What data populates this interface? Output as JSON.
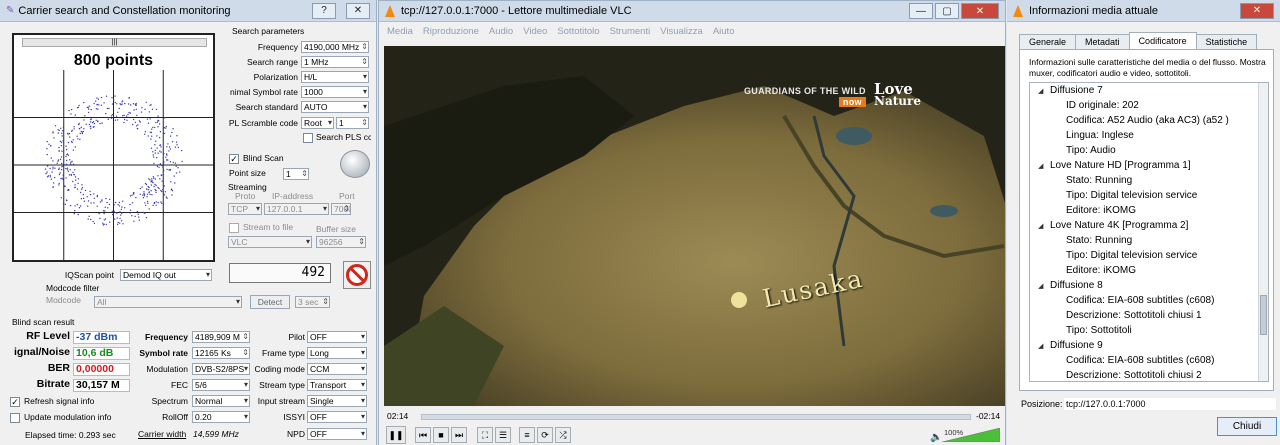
{
  "carrier": {
    "title": "Carrier search and Constellation monitoring",
    "title_btns": [
      "?",
      "✕"
    ],
    "constellation_title": "800 points",
    "scroll_label": "|||",
    "iqscan_label": "IQScan point",
    "iqscan_value": "Demod IQ out",
    "modcode_filter_label": "Modcode filter",
    "modcode_label": "Modcode",
    "modcode_value": "All",
    "detect_label": "Detect",
    "detect_sec": "3 sec",
    "counter": "492",
    "search_params": {
      "header": "Search parameters",
      "frequency_label": "Frequency",
      "frequency": "4190,000 MHz",
      "range_label": "Search range",
      "range": "1 MHz",
      "polarization_label": "Polarization",
      "polarization": "H/L",
      "symbol_label": "nimal Symbol rate",
      "symbol": "1000",
      "standard_label": "Search standard",
      "standard": "AUTO",
      "pl_label": "PL Scramble code",
      "pl_mode": "Root",
      "pl_value": "1",
      "pls_label": "Search PLS cc",
      "blind_label": "Blind Scan",
      "point_size_label": "Point size",
      "point_size": "1"
    },
    "streaming": {
      "header": "Streaming",
      "proto_label": "Proto",
      "ip_label": "IP-address",
      "port_label": "Port",
      "proto": "TCP",
      "ip": "127.0.0.1",
      "port": "7000",
      "stream_file_label": "Stream to file",
      "buffer_label": "Buffer size",
      "player": "VLC",
      "buffer": "96256"
    },
    "result": {
      "header": "Blind scan result",
      "rf_label": "RF Level",
      "rf_value": "-37 dBm",
      "sn_label": "ignal/Noise",
      "sn_value": "10,6 dB",
      "ber_label": "BER",
      "ber_value": "0,00000",
      "bitrate_label": "Bitrate",
      "bitrate_value": "30,157 M",
      "frequency_label": "Frequency",
      "frequency_value": "4189,909 M",
      "symbol_label": "Symbol rate",
      "symbol_value": "12165 Ks",
      "modulation_label": "Modulation",
      "modulation_value": "DVB-S2/8PS",
      "fec_label": "FEC",
      "fec_value": "5/6",
      "spectrum_label": "Spectrum",
      "spectrum_value": "Normal",
      "rolloff_label": "RollOff",
      "rolloff_value": "0.20",
      "carrier_width_label": "Carrier width",
      "carrier_width_value": "14,599 MHz",
      "pilot_label": "Pilot",
      "pilot_value": "OFF",
      "frame_label": "Frame type",
      "frame_value": "Long",
      "coding_label": "Coding mode",
      "coding_value": "CCM",
      "stream_type_label": "Stream type",
      "stream_type_value": "Transport",
      "input_stream_label": "Input stream",
      "input_stream_value": "Single",
      "issyi_label": "ISSYI",
      "issyi_value": "OFF",
      "npd_label": "NPD",
      "npd_value": "OFF",
      "refresh_label": "Refresh signal info",
      "update_label": "Update modulation info",
      "elapsed": "Elapsed time: 0.293 sec"
    }
  },
  "vlc": {
    "title": "tcp://127.0.0.1:7000 - Lettore multimediale VLC",
    "menu": [
      "Media",
      "Riproduzione",
      "Audio",
      "Video",
      "Sottotitolo",
      "Strumenti",
      "Visualizza",
      "Aiuto"
    ],
    "overlay_show": "GUARDIANS OF THE WILD",
    "overlay_now": "now",
    "logo_love": "Love",
    "logo_nature": "Nature",
    "city": "Lusaka",
    "time_elapsed": "02:14",
    "time_remaining": "-02:14",
    "volume": "100%"
  },
  "info": {
    "title": "Informazioni media attuale",
    "tabs": [
      "Generale",
      "Metadati",
      "Codificatore",
      "Statistiche"
    ],
    "active_tab": "Codificatore",
    "description": "Informazioni sulle caratteristiche del media o del flusso. Mostra muxer, codificatori audio e video, sottotitoli.",
    "tree": [
      {
        "level": 1,
        "text": "Diffusione 7"
      },
      {
        "level": 2,
        "text": "ID originale: 202"
      },
      {
        "level": 2,
        "text": "Codifica: A52 Audio (aka AC3) (a52 )"
      },
      {
        "level": 2,
        "text": "Lingua: Inglese"
      },
      {
        "level": 2,
        "text": "Tipo: Audio"
      },
      {
        "level": 1,
        "text": "Love Nature HD [Programma 1]"
      },
      {
        "level": 2,
        "text": "Stato: Running"
      },
      {
        "level": 2,
        "text": "Tipo: Digital television service"
      },
      {
        "level": 2,
        "text": "Editore: iKOMG"
      },
      {
        "level": 1,
        "text": "Love Nature 4K [Programma 2]"
      },
      {
        "level": 2,
        "text": "Stato: Running"
      },
      {
        "level": 2,
        "text": "Tipo: Digital television service"
      },
      {
        "level": 2,
        "text": "Editore: iKOMG"
      },
      {
        "level": 1,
        "text": "Diffusione 8"
      },
      {
        "level": 2,
        "text": "Codifica: EIA-608 subtitles (c608)"
      },
      {
        "level": 2,
        "text": "Descrizione: Sottotitoli chiusi 1"
      },
      {
        "level": 2,
        "text": "Tipo: Sottotitoli"
      },
      {
        "level": 1,
        "text": "Diffusione 9"
      },
      {
        "level": 2,
        "text": "Codifica: EIA-608 subtitles (c608)"
      },
      {
        "level": 2,
        "text": "Descrizione: Sottotitoli chiusi 2"
      }
    ],
    "location_label": "Posizione:",
    "location": "tcp://127.0.0.1:7000",
    "close_label": "Chiudi"
  }
}
